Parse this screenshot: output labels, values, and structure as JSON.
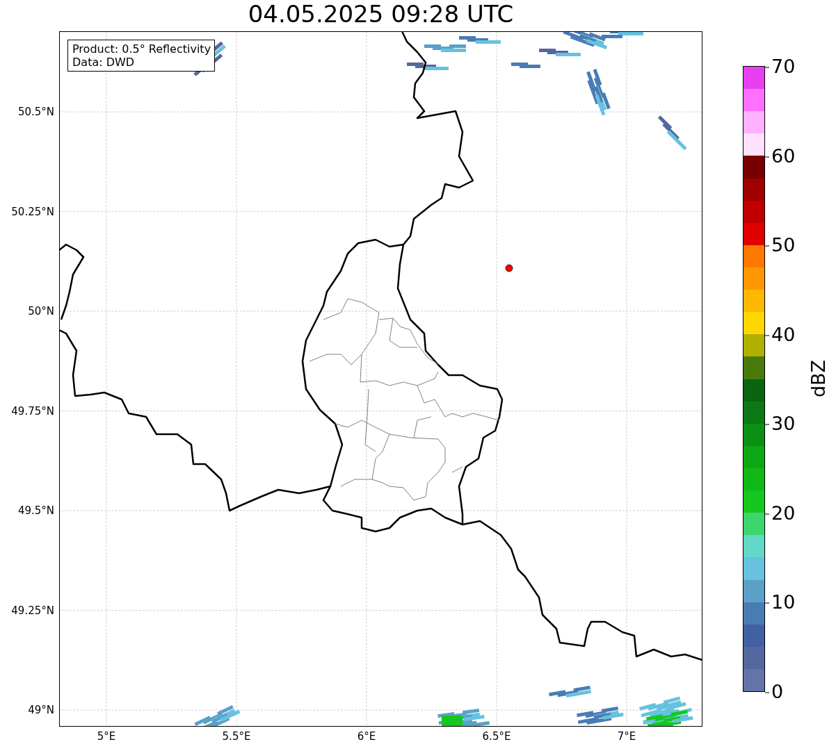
{
  "title": "04.05.2025 09:28 UTC",
  "legend": [
    "Product: 0.5° Reflectivity",
    "Data: DWD"
  ],
  "x_ticks": [
    "5°E",
    "5.5°E",
    "6°E",
    "6.5°E",
    "7°E"
  ],
  "y_ticks": [
    "50.5°N",
    "50.25°N",
    "50°N",
    "49.75°N",
    "49.5°N",
    "49.25°N",
    "49°N"
  ],
  "colorbar": {
    "label": "dBZ",
    "ticks": [
      "70",
      "60",
      "50",
      "40",
      "30",
      "20",
      "10",
      "0"
    ],
    "bands": [
      {
        "color": "#e840f0"
      },
      {
        "color": "#ff70ff"
      },
      {
        "color": "#ffb0ff"
      },
      {
        "color": "#ffe0ff"
      },
      {
        "color": "#780000"
      },
      {
        "color": "#a00000"
      },
      {
        "color": "#c00000"
      },
      {
        "color": "#e00000"
      },
      {
        "color": "#ff7800"
      },
      {
        "color": "#ff9800"
      },
      {
        "color": "#ffb800"
      },
      {
        "color": "#ffd700"
      },
      {
        "color": "#b0b000"
      },
      {
        "color": "#4a7a0c"
      },
      {
        "color": "#0a6410"
      },
      {
        "color": "#0c7a14"
      },
      {
        "color": "#0c9014"
      },
      {
        "color": "#0ea814"
      },
      {
        "color": "#10b818"
      },
      {
        "color": "#14c81e"
      },
      {
        "color": "#3dd66e"
      },
      {
        "color": "#62d8c8"
      },
      {
        "color": "#66c2de"
      },
      {
        "color": "#5aa0c8"
      },
      {
        "color": "#4a7cb4"
      },
      {
        "color": "#4360a4"
      },
      {
        "color": "#5468a0"
      },
      {
        "color": "#6474a8"
      }
    ]
  }
}
